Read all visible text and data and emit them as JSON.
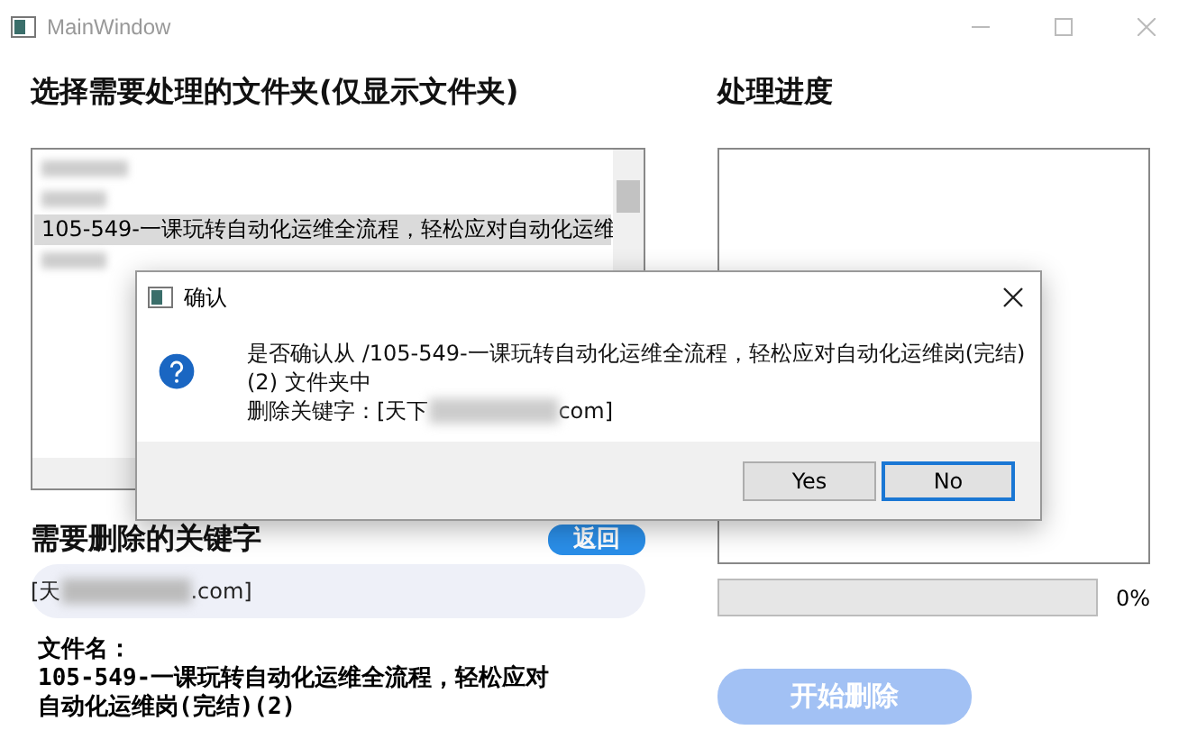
{
  "window": {
    "title": "MainWindow"
  },
  "folder_panel": {
    "heading": "选择需要处理的文件夹(仅显示文件夹)",
    "items": [
      {
        "kind": "redacted",
        "selected": false
      },
      {
        "kind": "redacted",
        "selected": false
      },
      {
        "kind": "text",
        "label": "105-549-一课玩转自动化运维全流程，轻松应对自动化运维",
        "selected": true
      },
      {
        "kind": "redacted",
        "selected": false
      }
    ]
  },
  "keyword_panel": {
    "heading": "需要删除的关键字",
    "back_button": "返回",
    "keyword_start": "[天",
    "keyword_end": ".com]"
  },
  "file_name": {
    "label": "文件名：",
    "value": "105-549-一课玩转自动化运维全流程，轻松应对自动化运维岗(完结)(2)"
  },
  "progress": {
    "heading": "处理进度",
    "level": 0,
    "reading": "0%"
  },
  "start_button": {
    "label": "开始删除",
    "disabled": true
  },
  "dialog": {
    "title": "确认",
    "message": "是否确认从 /105-549-一课玩转自动化运维全流程，轻松应对自动化运维岗(完结)(2) 文件夹中",
    "keyword_prefix": "删除关键字：[天下",
    "keyword_suffix": "com]",
    "buttons": [
      {
        "label": "Yes",
        "selected": false
      },
      {
        "label": "No",
        "selected": true
      }
    ]
  }
}
